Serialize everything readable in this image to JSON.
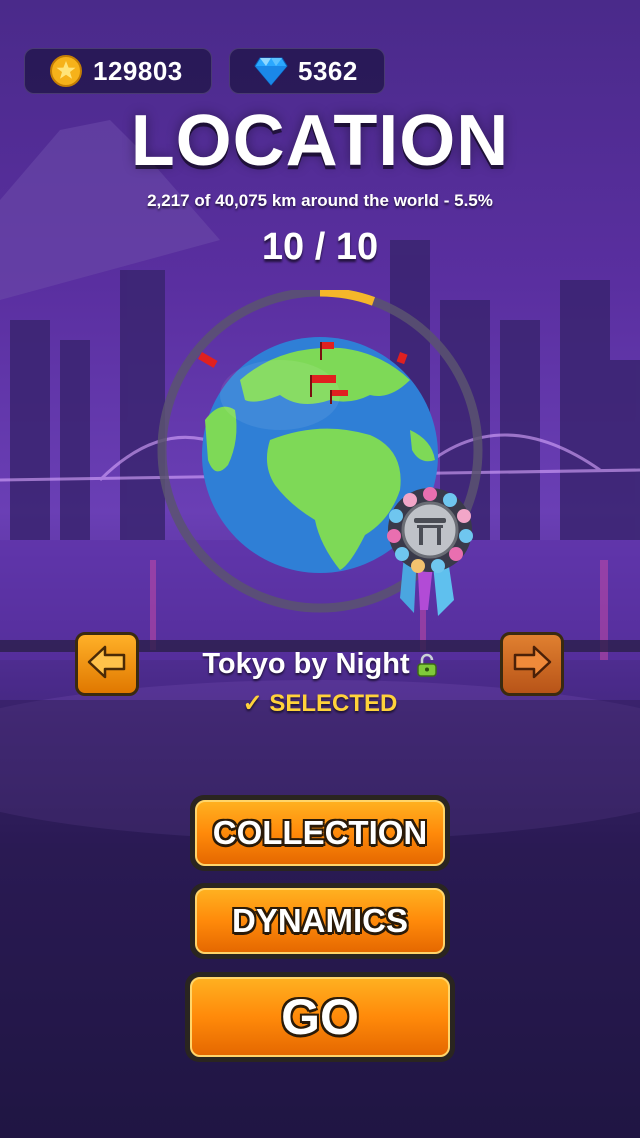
{
  "currency": {
    "coins": "129803",
    "gems": "5362",
    "coin_icon": "gold-coin-star-icon",
    "gem_icon": "blue-diamond-icon"
  },
  "header": {
    "title": "LOCATION",
    "subtitle": "2,217 of 40,075 km around the world - 5.5%",
    "progress": "10 / 10"
  },
  "globe": {
    "progress_fraction": 0.055,
    "ring_color": "#5a5470",
    "progress_color": "#f5b62a",
    "ocean_color": "#2f7fd6",
    "land_color": "#7ed957",
    "medal_icon": "torii-gate-medal-icon"
  },
  "location": {
    "name": "Tokyo by Night",
    "status": "✓ SELECTED",
    "lock_icon": "unlocked-padlock-icon"
  },
  "navigation": {
    "prev_icon": "arrow-left-icon",
    "next_icon": "arrow-right-icon"
  },
  "buttons": {
    "collection": "COLLECTION",
    "dynamics": "DYNAMICS",
    "go": "GO"
  },
  "colors": {
    "accent": "#ff8a0a",
    "selected": "#ffd23a"
  }
}
